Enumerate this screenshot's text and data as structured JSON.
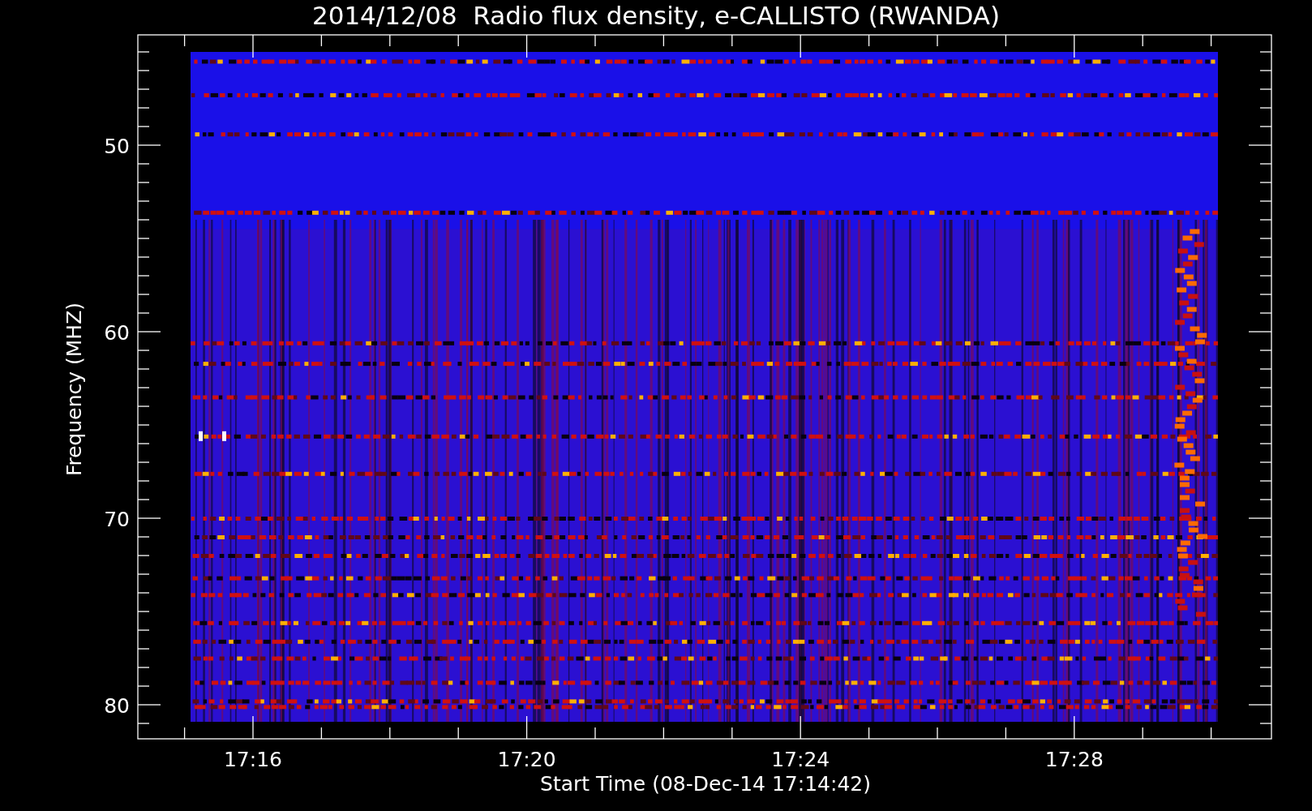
{
  "title": "2014/12/08  Radio flux density, e-CALLISTO (RWANDA)",
  "y_axis": {
    "label": "Frequency (MHZ)",
    "ticks": [
      "50",
      "60",
      "70",
      "80"
    ]
  },
  "x_axis": {
    "label": "Start Time (08-Dec-14 17:14:42)",
    "ticks": [
      "17:16",
      "17:20",
      "17:24",
      "17:28"
    ]
  }
}
